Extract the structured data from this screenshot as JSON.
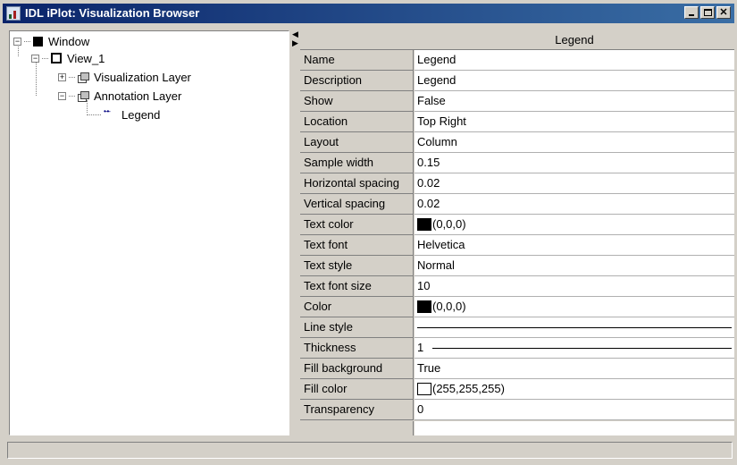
{
  "window": {
    "title": "IDL iPlot: Visualization Browser"
  },
  "tree": {
    "items": [
      {
        "label": "Window",
        "expander": "−"
      },
      {
        "label": "View_1",
        "expander": "−"
      },
      {
        "label": "Visualization Layer",
        "expander": "+"
      },
      {
        "label": "Annotation Layer",
        "expander": "−"
      },
      {
        "label": "Legend"
      }
    ]
  },
  "properties": {
    "header": "Legend",
    "rows": [
      {
        "name": "Name",
        "value": "Legend"
      },
      {
        "name": "Description",
        "value": "Legend"
      },
      {
        "name": "Show",
        "value": "False"
      },
      {
        "name": "Location",
        "value": "Top Right"
      },
      {
        "name": "Layout",
        "value": "Column"
      },
      {
        "name": "Sample width",
        "value": "0.15"
      },
      {
        "name": "Horizontal spacing",
        "value": "0.02"
      },
      {
        "name": "Vertical spacing",
        "value": "0.02"
      },
      {
        "name": "Text color",
        "value": "(0,0,0)",
        "swatch": "#000000"
      },
      {
        "name": "Text font",
        "value": "Helvetica"
      },
      {
        "name": "Text style",
        "value": "Normal"
      },
      {
        "name": "Text font size",
        "value": "10"
      },
      {
        "name": "Color",
        "value": "(0,0,0)",
        "swatch": "#000000"
      },
      {
        "name": "Line style",
        "value": ""
      },
      {
        "name": "Thickness",
        "value": "1"
      },
      {
        "name": "Fill background",
        "value": "True"
      },
      {
        "name": "Fill color",
        "value": "(255,255,255)",
        "swatch": "#ffffff"
      },
      {
        "name": "Transparency",
        "value": "0"
      }
    ]
  },
  "colors": {
    "titlebar_start": "#0a246a",
    "titlebar_end": "#3a6ea5",
    "face": "#d4d0c8"
  },
  "icons": [
    "app-icon",
    "minimize-icon",
    "maximize-icon",
    "close-icon",
    "window-icon",
    "view-icon",
    "layer-icon",
    "legend-icon"
  ]
}
